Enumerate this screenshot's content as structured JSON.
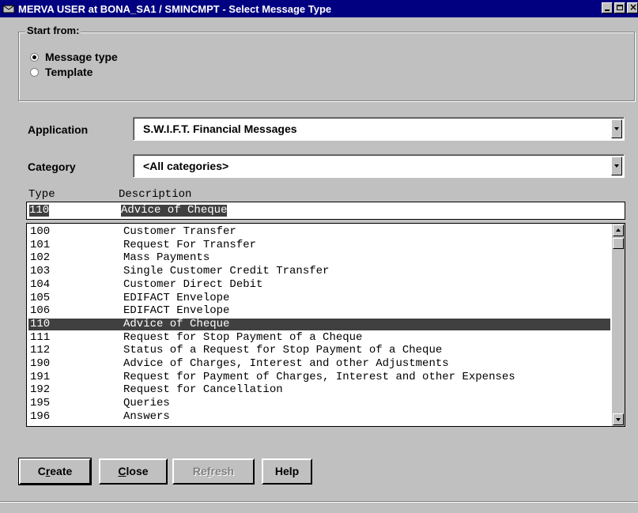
{
  "window": {
    "title": "MERVA USER at BONA_SA1 / SMINCMPT - Select Message Type"
  },
  "start_from": {
    "legend": "Start from:",
    "options": [
      {
        "label": "Message type",
        "selected": true
      },
      {
        "label": "Template",
        "selected": false
      }
    ]
  },
  "application": {
    "label": "Application",
    "value": "S.W.I.F.T. Financial Messages"
  },
  "category": {
    "label": "Category",
    "value": "<All categories>"
  },
  "columns": {
    "type": "Type",
    "description": "Description"
  },
  "selected": {
    "type": "110",
    "description": "Advice of Cheque"
  },
  "messages": [
    {
      "type": "100",
      "description": "Customer Transfer"
    },
    {
      "type": "101",
      "description": "Request For Transfer"
    },
    {
      "type": "102",
      "description": "Mass Payments"
    },
    {
      "type": "103",
      "description": "Single Customer Credit Transfer"
    },
    {
      "type": "104",
      "description": "Customer Direct Debit"
    },
    {
      "type": "105",
      "description": "EDIFACT Envelope"
    },
    {
      "type": "106",
      "description": "EDIFACT Envelope"
    },
    {
      "type": "110",
      "description": "Advice of Cheque",
      "highlighted": true
    },
    {
      "type": "111",
      "description": "Request for Stop Payment of a Cheque"
    },
    {
      "type": "112",
      "description": "Status of a Request for Stop Payment of a Cheque"
    },
    {
      "type": "190",
      "description": "Advice of Charges, Interest and other Adjustments"
    },
    {
      "type": "191",
      "description": "Request for Payment of Charges, Interest and other Expenses"
    },
    {
      "type": "192",
      "description": "Request for Cancellation"
    },
    {
      "type": "195",
      "description": "Queries"
    },
    {
      "type": "196",
      "description": "Answers"
    }
  ],
  "buttons": {
    "create": {
      "pre": "C",
      "mnemonic": "r",
      "post": "eate"
    },
    "close": {
      "pre": "",
      "mnemonic": "C",
      "post": "lose"
    },
    "refresh": {
      "pre": "Re",
      "mnemonic": "f",
      "post": "resh"
    },
    "help": {
      "label": "Help"
    }
  },
  "colors": {
    "titlebar": "#000080",
    "face": "#c0c0c0",
    "highlight": "#404040"
  }
}
